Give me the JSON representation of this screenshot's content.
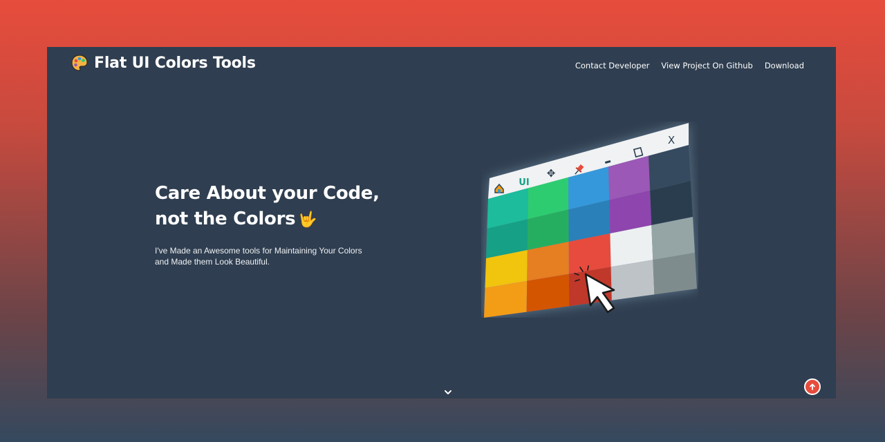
{
  "brand": {
    "title": "Flat UI Colors Tools",
    "logo_icon": "palette-icon"
  },
  "nav": {
    "items": [
      {
        "label": "Contact Developer"
      },
      {
        "label": "View Project On Github"
      },
      {
        "label": "Download"
      }
    ]
  },
  "hero": {
    "title_line1": "Care About your Code,",
    "title_line2": "not the Colors",
    "title_emoji": "🤟",
    "subtitle": "I've Made an Awesome tools for Maintaining Your Colors and Made them Look Beautiful."
  },
  "illustration": {
    "window_label": "UI",
    "toolbar_icons": [
      "home-icon",
      "ui-logo-icon",
      "move-icon",
      "pin-icon",
      "minimize-icon",
      "maximize-icon",
      "close-icon"
    ],
    "close_glyph": "X",
    "palette": [
      [
        "#1abc9c",
        "#2ecc71",
        "#3498db",
        "#9b59b6",
        "#34495e"
      ],
      [
        "#16a085",
        "#27ae60",
        "#2980b9",
        "#8e44ad",
        "#2c3e50"
      ],
      [
        "#f1c40f",
        "#e67e22",
        "#e74c3c",
        "#ecf0f1",
        "#95a5a6"
      ],
      [
        "#f39c12",
        "#d35400",
        "#c0392b",
        "#bdc3c7",
        "#7f8c8d"
      ]
    ]
  },
  "controls": {
    "scroll_down_icon": "chevron-down-icon",
    "back_to_top_icon": "arrow-up-icon"
  },
  "colors": {
    "background_top": "#e74c3c",
    "background_bottom": "#34495e",
    "panel": "#2f3e50",
    "accent": "#e74c3c"
  }
}
